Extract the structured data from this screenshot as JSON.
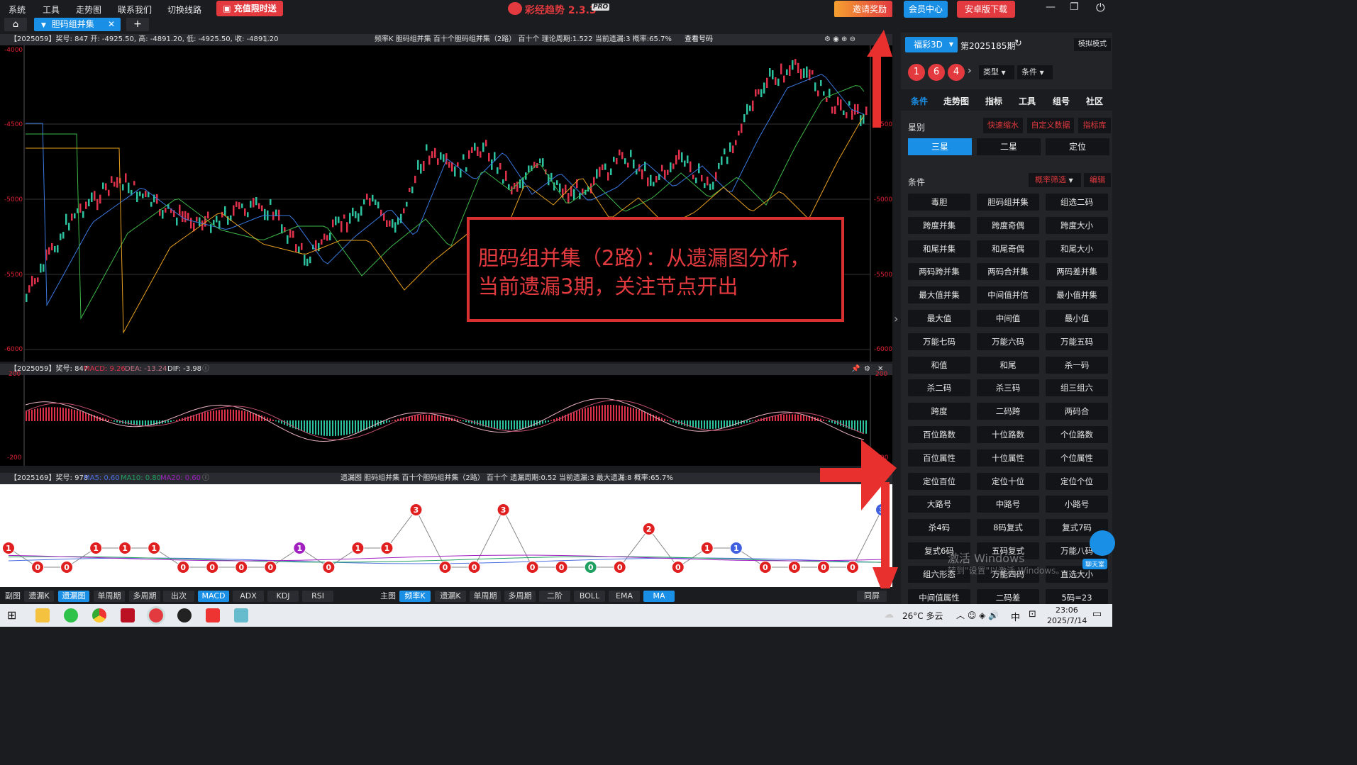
{
  "menubar": {
    "items": [
      "系统",
      "工具",
      "走势图",
      "联系我们",
      "切换线路"
    ],
    "promo": "充值限时送",
    "app_title": "彩经趋势 2.3.3",
    "pro_badge": "PRO",
    "invite": "邀请奖励",
    "member": "会员中心",
    "android": "安卓版下载"
  },
  "tabs": {
    "active": "胆码组并集",
    "add": "+"
  },
  "main_chart": {
    "header_left": "【2025059】奖号: 847  开: -4925.50, 高: -4891.20, 低: -4925.50, 收: -4891.20",
    "header_center": "频率K  胆码组并集  百十个胆码组并集（2路）  百十个  理论周期:1.522  当前遗漏:3  概率:65.7%",
    "view_numbers": "查看号码",
    "yticks": [
      "-4000",
      "-4500",
      "-5000",
      "-5500",
      "-6000"
    ],
    "annotation_line1": "胆码组并集（2路）：从遗漏图分析，",
    "annotation_line2": "当前遗漏3期，关注节点开出"
  },
  "macd": {
    "header": "【2025059】奖号: 847",
    "macd": "MACD: 9.26",
    "dea": "DEA: -13.24",
    "dif": "DIF: -3.98",
    "yticks": [
      "200",
      "-200"
    ]
  },
  "omission": {
    "header": "【2025169】奖号: 978",
    "ma5": "MA5: 0.60",
    "ma10": "MA10: 0.80",
    "ma20": "MA20: 0.60",
    "header_center": "遗漏图  胆码组并集  百十个胆码组并集（2路）  百十个  遗漏周期:0.52  当前遗漏:3  最大遗漏:8  概率:65.7%"
  },
  "chart_data": {
    "type": "line",
    "omission_points": [
      1,
      0,
      0,
      1,
      1,
      1,
      0,
      0,
      0,
      0,
      1,
      0,
      1,
      1,
      3,
      0,
      0,
      3,
      0,
      0,
      0,
      0,
      2,
      0,
      1,
      1,
      0,
      0,
      0,
      0,
      3
    ],
    "omission_colors": {
      "0": "#e02020",
      "1": "#e02020",
      "2": "#e02020",
      "3": "#e02020",
      "purple": "#a020c0",
      "green": "#1fa060",
      "blue": "#4060e0"
    }
  },
  "bottombar": {
    "left": [
      "副图",
      "遗漏K",
      "遗漏图",
      "单周期",
      "多周期",
      "出次",
      "MACD",
      "ADX",
      "KDJ",
      "RSI"
    ],
    "mid": [
      "主图",
      "频率K",
      "遗漏K",
      "单周期",
      "多周期",
      "二阶",
      "BOLL",
      "EMA",
      "MA"
    ],
    "right": "同屏"
  },
  "right": {
    "lottery": "福彩3D",
    "period": "第2025185期",
    "sim": "模拟模式",
    "balls": [
      "1",
      "6",
      "4"
    ],
    "type": "类型",
    "cond": "条件",
    "tabs": [
      "条件",
      "走势图",
      "指标",
      "工具",
      "组号",
      "社区"
    ],
    "star_label": "星别",
    "quick": "快速缩水",
    "custom": "自定义数据",
    "lib": "指标库",
    "stars": [
      "三星",
      "二星",
      "定位"
    ],
    "cond_label": "条件",
    "filter": "概率筛选",
    "edit": "编辑",
    "buttons": [
      "毒胆",
      "胆码组并集",
      "组选二码",
      "跨度并集",
      "跨度奇偶",
      "跨度大小",
      "和尾并集",
      "和尾奇偶",
      "和尾大小",
      "两码跨并集",
      "两码合并集",
      "两码差并集",
      "最大值并集",
      "中间值并信",
      "最小值并集",
      "最大值",
      "中间值",
      "最小值",
      "万能七码",
      "万能六码",
      "万能五码",
      "和值",
      "和尾",
      "杀一码",
      "杀二码",
      "杀三码",
      "组三组六",
      "跨度",
      "二码跨",
      "两码合",
      "百位路数",
      "十位路数",
      "个位路数",
      "百位属性",
      "十位属性",
      "个位属性",
      "定位百位",
      "定位十位",
      "定位个位",
      "大路号",
      "中路号",
      "小路号",
      "杀4码",
      "8码复式",
      "复式7码",
      "复式6码",
      "五码复式",
      "万能八码",
      "组六形态",
      "万能四码",
      "直选大小",
      "中间值属性",
      "二码差",
      "5码=23"
    ],
    "chat": "聊天室",
    "watermark1": "激活 Windows",
    "watermark2": "转到\"设置\"以激活 Windows。"
  },
  "taskbar": {
    "weather": "26°C 多云",
    "time": "23:06",
    "date": "2025/7/14",
    "ime": "中"
  }
}
